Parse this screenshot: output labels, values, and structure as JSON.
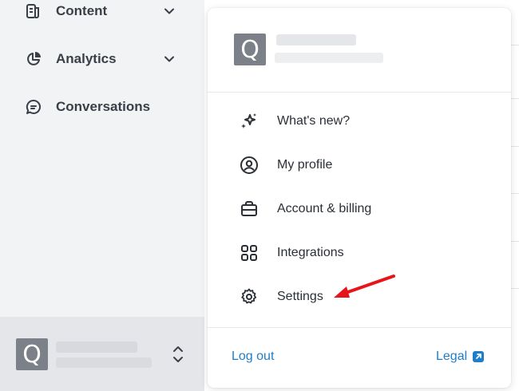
{
  "sidebar": {
    "items": [
      {
        "label": "Content",
        "icon": "content-icon",
        "has_chevron": true
      },
      {
        "label": "Analytics",
        "icon": "analytics-icon",
        "has_chevron": true
      },
      {
        "label": "Conversations",
        "icon": "conversations-icon",
        "has_chevron": false
      }
    ],
    "footer": {
      "avatar_letter": "Q",
      "switch_icon": "chevron-up-down-icon"
    }
  },
  "menu": {
    "header": {
      "avatar_letter": "Q"
    },
    "items": [
      {
        "label": "What's new?",
        "icon": "sparkles-icon"
      },
      {
        "label": "My profile",
        "icon": "user-circle-icon"
      },
      {
        "label": "Account & billing",
        "icon": "briefcase-icon"
      },
      {
        "label": "Integrations",
        "icon": "grid-icon"
      },
      {
        "label": "Settings",
        "icon": "gear-icon"
      }
    ],
    "footer": {
      "logout_label": "Log out",
      "legal_label": "Legal",
      "legal_icon": "external-link-icon"
    }
  },
  "colors": {
    "sidebar_bg": "#f2f3f5",
    "footer_bg": "#e4e6ea",
    "link": "#1f7ec9",
    "arrow": "#e8141b",
    "avatar": "#7b8089"
  }
}
